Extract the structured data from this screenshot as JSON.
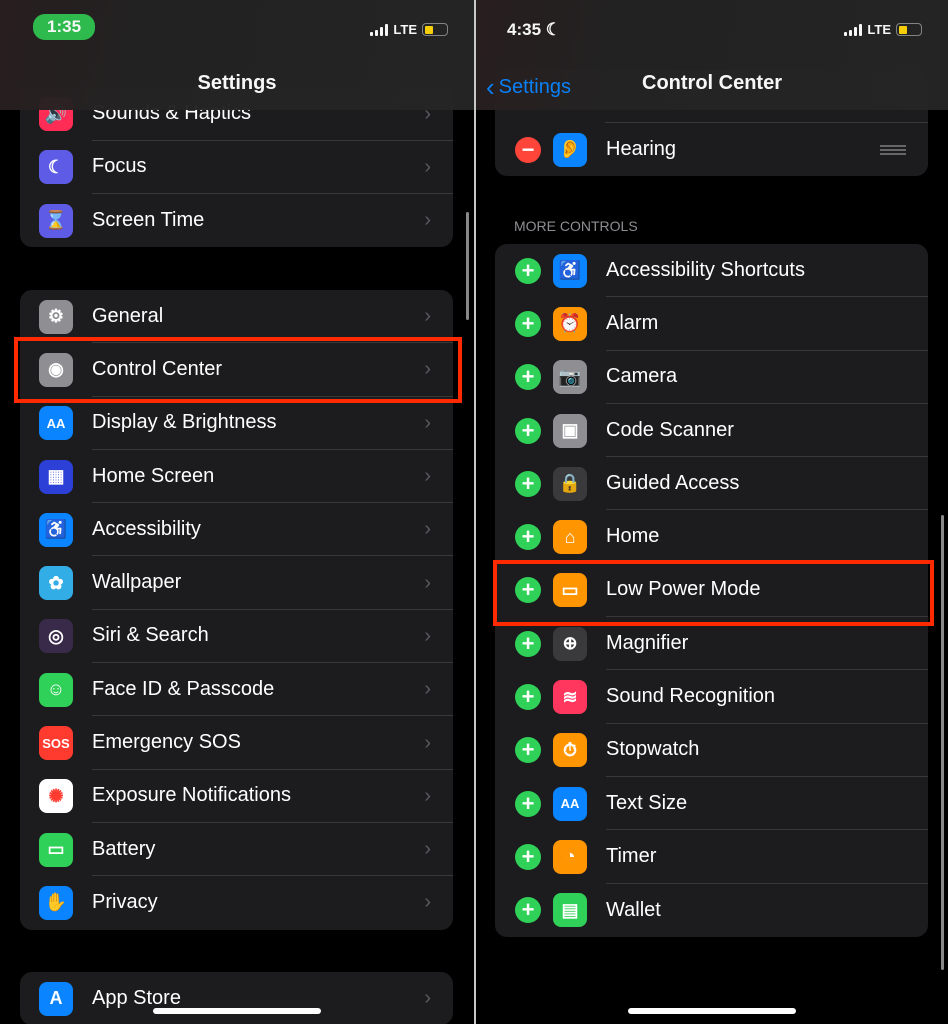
{
  "left": {
    "status": {
      "time": "1:35",
      "network": "LTE"
    },
    "title": "Settings",
    "groups": [
      [
        {
          "label": "Sounds & Haptics",
          "icon": "speaker-icon",
          "color": "#ff2d55",
          "glyph": "🔊"
        },
        {
          "label": "Focus",
          "icon": "moon-icon",
          "color": "#5e5ce6",
          "glyph": "☾"
        },
        {
          "label": "Screen Time",
          "icon": "hourglass-icon",
          "color": "#5e5ce6",
          "glyph": "⌛"
        }
      ],
      [
        {
          "label": "General",
          "icon": "gear-icon",
          "color": "#8e8e93",
          "glyph": "⚙"
        },
        {
          "label": "Control Center",
          "icon": "toggles-icon",
          "color": "#8e8e93",
          "glyph": "◉"
        },
        {
          "label": "Display & Brightness",
          "icon": "text-size-icon",
          "color": "#0a84ff",
          "glyph": "AA"
        },
        {
          "label": "Home Screen",
          "icon": "app-grid-icon",
          "color": "#2c3fd6",
          "glyph": "▦"
        },
        {
          "label": "Accessibility",
          "icon": "accessibility-icon",
          "color": "#0a84ff",
          "glyph": "♿"
        },
        {
          "label": "Wallpaper",
          "icon": "flower-icon",
          "color": "#32ade6",
          "glyph": "✿"
        },
        {
          "label": "Siri & Search",
          "icon": "siri-icon",
          "color": "#3a2a4a",
          "glyph": "◎"
        },
        {
          "label": "Face ID & Passcode",
          "icon": "face-id-icon",
          "color": "#30d158",
          "glyph": "☺"
        },
        {
          "label": "Emergency SOS",
          "icon": "sos-icon",
          "color": "#ff3b30",
          "glyph": "SOS"
        },
        {
          "label": "Exposure Notifications",
          "icon": "exposure-icon",
          "color": "#ffffff",
          "glyph": "✺"
        },
        {
          "label": "Battery",
          "icon": "battery-icon",
          "color": "#30d158",
          "glyph": "▭"
        },
        {
          "label": "Privacy",
          "icon": "hand-icon",
          "color": "#0a84ff",
          "glyph": "✋"
        }
      ],
      [
        {
          "label": "App Store",
          "icon": "app-store-icon",
          "color": "#0a84ff",
          "glyph": "A"
        }
      ]
    ]
  },
  "right": {
    "status": {
      "time": "4:35",
      "network": "LTE"
    },
    "back_label": "Settings",
    "title": "Control Center",
    "included": [
      {
        "label": "Hearing",
        "icon": "ear-icon",
        "color": "#0a84ff",
        "glyph": "👂"
      }
    ],
    "section_header": "MORE CONTROLS",
    "more_controls": [
      {
        "label": "Accessibility Shortcuts",
        "icon": "accessibility-icon",
        "color": "#0a84ff",
        "glyph": "♿"
      },
      {
        "label": "Alarm",
        "icon": "alarm-icon",
        "color": "#ff9500",
        "glyph": "⏰"
      },
      {
        "label": "Camera",
        "icon": "camera-icon",
        "color": "#8e8e93",
        "glyph": "📷"
      },
      {
        "label": "Code Scanner",
        "icon": "qr-code-icon",
        "color": "#8e8e93",
        "glyph": "▣"
      },
      {
        "label": "Guided Access",
        "icon": "lock-icon",
        "color": "#3a3a3c",
        "glyph": "🔒"
      },
      {
        "label": "Home",
        "icon": "house-icon",
        "color": "#ff9500",
        "glyph": "⌂"
      },
      {
        "label": "Low Power Mode",
        "icon": "battery-icon",
        "color": "#ff9500",
        "glyph": "▭"
      },
      {
        "label": "Magnifier",
        "icon": "magnifier-icon",
        "color": "#3a3a3c",
        "glyph": "⊕"
      },
      {
        "label": "Sound Recognition",
        "icon": "waveform-icon",
        "color": "#ff375f",
        "glyph": "≋"
      },
      {
        "label": "Stopwatch",
        "icon": "stopwatch-icon",
        "color": "#ff9500",
        "glyph": "⏱"
      },
      {
        "label": "Text Size",
        "icon": "text-size-icon",
        "color": "#0a84ff",
        "glyph": "AA"
      },
      {
        "label": "Timer",
        "icon": "timer-icon",
        "color": "#ff9500",
        "glyph": "◔"
      },
      {
        "label": "Wallet",
        "icon": "wallet-icon",
        "color": "#30d158",
        "glyph": "▤"
      }
    ]
  },
  "colors": {
    "highlight": "#ff2a00",
    "accent": "#0a84ff",
    "add": "#30d158",
    "remove": "#ff453a"
  }
}
